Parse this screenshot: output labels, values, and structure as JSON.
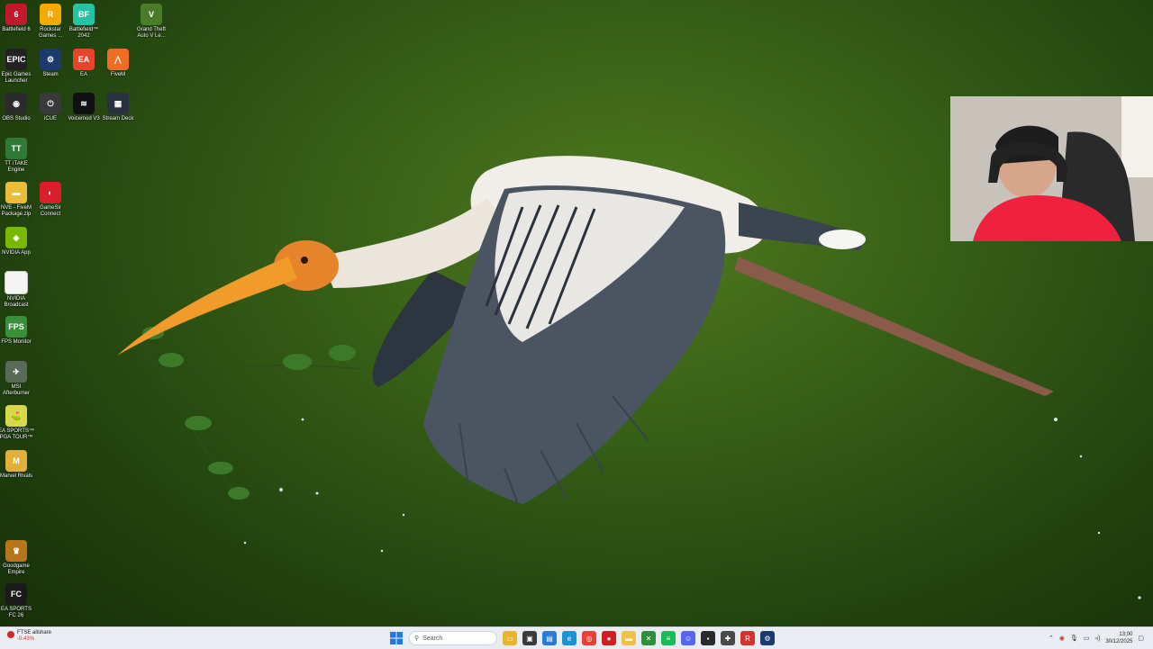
{
  "desktop_icons": [
    {
      "label": "Battlefield 6",
      "icon": "battlefield-6-icon",
      "color": "#c2182b"
    },
    {
      "label": "Rockstar Games ...",
      "icon": "rockstar-games-icon",
      "color": "#f2a900"
    },
    {
      "label": "Battlefield™ 2042",
      "icon": "battlefield-2042-icon",
      "color": "#25c3a6"
    },
    {
      "label": "Grand Theft Auto V Le...",
      "icon": "gta-v-icon",
      "color": "#4a7c2a"
    },
    {
      "label": "Epic Games Launcher",
      "icon": "epic-games-icon",
      "color": "#222222"
    },
    {
      "label": "Steam",
      "icon": "steam-icon",
      "color": "#1b3b6f"
    },
    {
      "label": "EA",
      "icon": "ea-icon",
      "color": "#e8442b"
    },
    {
      "label": "FiveM",
      "icon": "fivem-icon",
      "color": "#f06c23"
    },
    {
      "label": "OBS Studio",
      "icon": "obs-icon",
      "color": "#2b2b2b"
    },
    {
      "label": "iCUE",
      "icon": "icue-icon",
      "color": "#3a3a3a"
    },
    {
      "label": "Voicemod V3",
      "icon": "voicemod-icon",
      "color": "#111111"
    },
    {
      "label": "Stream Deck",
      "icon": "stream-deck-icon",
      "color": "#2a3140"
    },
    {
      "label": "TT iTAKE Engine",
      "icon": "tt-itake-icon",
      "color": "#2f7a38"
    },
    {
      "label": "NVE - FiveM Package.zip",
      "icon": "folder-zip-icon",
      "color": "#e9bd3a"
    },
    {
      "label": "GameSir Connect",
      "icon": "gamesir-icon",
      "color": "#d9202a"
    },
    {
      "label": "NVIDIA App",
      "icon": "nvidia-icon",
      "color": "#76b900"
    },
    {
      "label": "NVIDIA Broadcast",
      "icon": "document-icon",
      "color": "#f4f4f4"
    },
    {
      "label": "FPS Monitor",
      "icon": "fps-monitor-icon",
      "color": "#3a8f3a"
    },
    {
      "label": "MSI Afterburner",
      "icon": "msi-afterburner-icon",
      "color": "#5a6a5a"
    },
    {
      "label": "EA SPORTS™ PGA TOUR™",
      "icon": "pga-tour-icon",
      "color": "#d7d94a"
    },
    {
      "label": "Marvel Rivals",
      "icon": "marvel-rivals-icon",
      "color": "#e0b03a"
    },
    {
      "label": "Goodgame Empire",
      "icon": "goodgame-empire-icon",
      "color": "#b8761a"
    },
    {
      "label": "EA SPORTS FC 26",
      "icon": "ea-fc26-icon",
      "color": "#1a1a1a"
    }
  ],
  "glyphs": {
    "battlefield-6-icon": "6",
    "rockstar-games-icon": "R",
    "battlefield-2042-icon": "BF",
    "gta-v-icon": "V",
    "epic-games-icon": "EPIC",
    "steam-icon": "⚙",
    "ea-icon": "EA",
    "fivem-icon": "⋀",
    "obs-icon": "◉",
    "icue-icon": "⏻",
    "voicemod-icon": "≋",
    "stream-deck-icon": "▦",
    "tt-itake-icon": "TT",
    "folder-zip-icon": "▬",
    "gamesir-icon": "◐",
    "nvidia-icon": "◈",
    "document-icon": "",
    "fps-monitor-icon": "FPS",
    "msi-afterburner-icon": "✈",
    "pga-tour-icon": "⛳",
    "marvel-rivals-icon": "M",
    "goodgame-empire-icon": "♛",
    "ea-fc26-icon": "FC"
  },
  "taskbar": {
    "widget_title": "FTSE allshare",
    "widget_change": "-0.43%",
    "search_placeholder": "Search",
    "apps": [
      {
        "name": "file-explorer-icon",
        "color": "#e9b52f",
        "glyph": "▭"
      },
      {
        "name": "task-view-icon",
        "color": "#3a3a3a",
        "glyph": "▣"
      },
      {
        "name": "store-icon",
        "color": "#2b7bd6",
        "glyph": "▤"
      },
      {
        "name": "edge-icon",
        "color": "#1f8fd8",
        "glyph": "e"
      },
      {
        "name": "chrome-icon",
        "color": "#e94235",
        "glyph": "◎"
      },
      {
        "name": "record-icon",
        "color": "#d11f1f",
        "glyph": "●"
      },
      {
        "name": "folder-icon",
        "color": "#efc14a",
        "glyph": "▬"
      },
      {
        "name": "xbox-icon",
        "color": "#2c8f3a",
        "glyph": "✕"
      },
      {
        "name": "spotify-icon",
        "color": "#1db954",
        "glyph": "≡"
      },
      {
        "name": "discord-icon",
        "color": "#5865f2",
        "glyph": "☺"
      },
      {
        "name": "terminal-icon",
        "color": "#2a2a2a",
        "glyph": "▪"
      },
      {
        "name": "controller-icon",
        "color": "#4a4a4a",
        "glyph": "✚"
      },
      {
        "name": "rockstar-taskbar-icon",
        "color": "#d3322d",
        "glyph": "R"
      },
      {
        "name": "steam-taskbar-icon",
        "color": "#1b3b6f",
        "glyph": "⚙"
      }
    ],
    "clock_time": "13:00",
    "clock_date": "30/12/2025"
  }
}
